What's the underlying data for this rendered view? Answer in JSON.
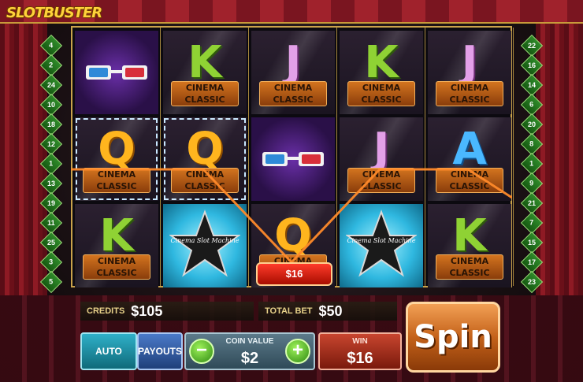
{
  "app": {
    "logo": "SLOTBUSTER"
  },
  "lines_left": [
    "4",
    "2",
    "24",
    "10",
    "18",
    "12",
    "1",
    "13",
    "19",
    "11",
    "25",
    "3",
    "5"
  ],
  "lines_right": [
    "22",
    "16",
    "14",
    "6",
    "20",
    "8",
    "1",
    "9",
    "21",
    "7",
    "15",
    "17",
    "23"
  ],
  "reels": [
    [
      {
        "type": "glasses"
      },
      {
        "type": "letter",
        "letter": "Q",
        "cls": "q",
        "label": "CINEMA CLASSIC",
        "win": true
      },
      {
        "type": "letter",
        "letter": "K",
        "cls": "k",
        "label": "CINEMA CLASSIC"
      }
    ],
    [
      {
        "type": "letter",
        "letter": "K",
        "cls": "k",
        "label": "CINEMA CLASSIC"
      },
      {
        "type": "letter",
        "letter": "Q",
        "cls": "q",
        "label": "CINEMA CLASSIC",
        "win": true
      },
      {
        "type": "star",
        "star_text": "Cinema Slot Machine"
      }
    ],
    [
      {
        "type": "letter",
        "letter": "J",
        "cls": "j",
        "label": "CINEMA CLASSIC"
      },
      {
        "type": "glasses"
      },
      {
        "type": "letter",
        "letter": "Q",
        "cls": "q",
        "label": "CINEMA CLASSIC"
      }
    ],
    [
      {
        "type": "letter",
        "letter": "K",
        "cls": "k",
        "label": "CINEMA CLASSIC"
      },
      {
        "type": "letter",
        "letter": "J",
        "cls": "j",
        "label": "CINEMA CLASSIC"
      },
      {
        "type": "star",
        "star_text": "Cinema Slot Machine"
      }
    ],
    [
      {
        "type": "letter",
        "letter": "J",
        "cls": "j",
        "label": "CINEMA CLASSIC"
      },
      {
        "type": "letter",
        "letter": "A",
        "cls": "a",
        "label": "CINEMA CLASSIC"
      },
      {
        "type": "letter",
        "letter": "K",
        "cls": "k",
        "label": "CINEMA CLASSIC"
      }
    ]
  ],
  "win_badge": "$16",
  "credits": {
    "label": "CREDITS",
    "value": "$105"
  },
  "total_bet": {
    "label": "TOTAL BET",
    "value": "$50"
  },
  "buttons": {
    "auto": "AUTO",
    "payouts": "PAYOUTS",
    "spin": "Spin",
    "minus": "−",
    "plus": "+"
  },
  "coin": {
    "label": "COIN VALUE",
    "value": "$2"
  },
  "win": {
    "label": "WIN",
    "value": "$16"
  }
}
